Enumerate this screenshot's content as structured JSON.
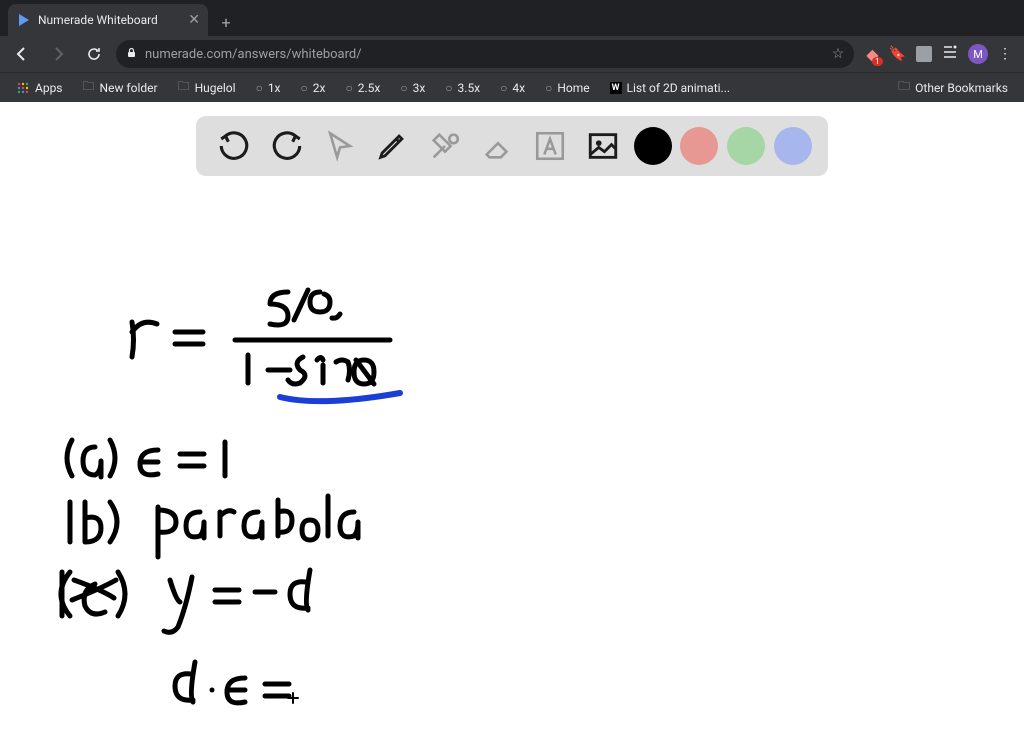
{
  "browser": {
    "tab_title": "Numerade Whiteboard",
    "url": "numerade.com/answers/whiteboard/",
    "avatar_initial": "M",
    "ext_badge_count": "1"
  },
  "bookmarks": {
    "apps": "Apps",
    "items": [
      "New folder",
      "Hugelol",
      "1x",
      "2x",
      "2.5x",
      "3x",
      "3.5x",
      "4x",
      "Home",
      "List of 2D animati..."
    ],
    "other": "Other Bookmarks"
  },
  "toolbar": {
    "undo": "undo",
    "redo": "redo",
    "select": "select",
    "pencil": "pencil",
    "tools": "tools",
    "eraser": "eraser",
    "text": "text",
    "image": "image"
  },
  "colors": {
    "black": "#000000",
    "red": "#e89892",
    "green": "#a6d5a6",
    "blue": "#a7b6ed"
  },
  "whiteboard_content": {
    "equation": "r = (5/2) / (1 - sinθ)",
    "line_a": "(a) e = 1",
    "line_b": "(b) parabola",
    "line_c": "(c) y = -d",
    "line_d": "d·e =",
    "accent_stroke_color": "#1a3fd6"
  }
}
